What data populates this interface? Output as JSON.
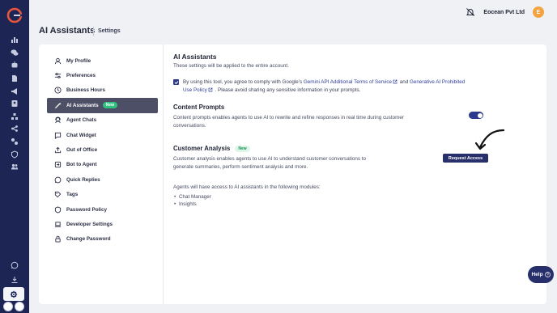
{
  "topbar": {
    "company": "Eocean Pvt Ltd",
    "avatar_letter": "E"
  },
  "header": {
    "title": "AI Assistants",
    "breadcrumb": "Settings"
  },
  "menu": [
    {
      "label": "My Profile",
      "icon": "user-icon"
    },
    {
      "label": "Preferences",
      "icon": "sliders-icon"
    },
    {
      "label": "Business Hours",
      "icon": "clock-icon"
    },
    {
      "label": "AI Assistants",
      "icon": "wand-icon",
      "badge": "New",
      "active": true
    },
    {
      "label": "Agent Chats",
      "icon": "agent-icon"
    },
    {
      "label": "Chat Widget",
      "icon": "chat-icon"
    },
    {
      "label": "Out of Office",
      "icon": "upload-icon"
    },
    {
      "label": "Bot to Agent",
      "icon": "transfer-icon"
    },
    {
      "label": "Quick Replies",
      "icon": "reply-icon"
    },
    {
      "label": "Tags",
      "icon": "tag-icon"
    },
    {
      "label": "Password Policy",
      "icon": "shield-icon"
    },
    {
      "label": "Developer Settings",
      "icon": "laptop-icon"
    },
    {
      "label": "Change Password",
      "icon": "lock-icon"
    }
  ],
  "content": {
    "title": "AI Assistants",
    "subtitle": "These settings will be applied to the entire account.",
    "consent": {
      "prefix": "By using this tool, you agree to comply with Google's ",
      "link1": "Gemini API Additional Terms of Service",
      "middle": " and ",
      "link2": "Generative AI Prohibited Use Policy",
      "suffix": " . Please avoid sharing any sensitive information in your prompts."
    },
    "content_prompts": {
      "title": "Content Prompts",
      "description": "Content prompts enables agents to use AI to rewrite and refine responses in real time during customer conversations.",
      "enabled": true
    },
    "customer_analysis": {
      "title": "Customer Analysis",
      "badge": "New",
      "description": "Customer analysis enables agents to use AI to understand customer conversations to generate summaries, perform sentiment analysis and more.",
      "button": "Request Access"
    },
    "modules": {
      "intro": "Agents will have access to AI assistants in the following modules:",
      "items": [
        "Chat Manager",
        "Insights"
      ]
    }
  },
  "help": {
    "label": "Help"
  },
  "colors": {
    "rail": "#1d2554",
    "primary": "#28306b",
    "accent": "#f4a340",
    "new_badge": "#2ec27e"
  }
}
